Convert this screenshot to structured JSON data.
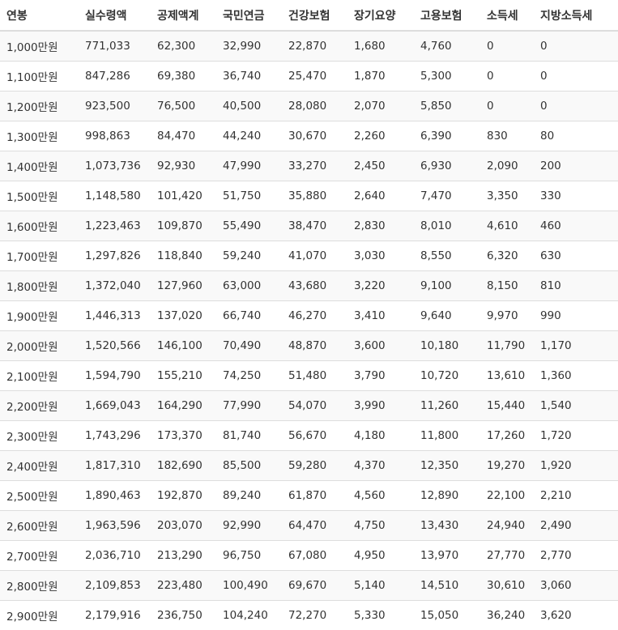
{
  "table": {
    "headers": [
      "연봉",
      "실수령액",
      "공제액계",
      "국민연금",
      "건강보험",
      "장기요양",
      "고용보험",
      "소득세",
      "지방소득세"
    ],
    "rows": [
      [
        "1,000만원",
        "771,033",
        "62,300",
        "32,990",
        "22,870",
        "1,680",
        "4,760",
        "0",
        "0"
      ],
      [
        "1,100만원",
        "847,286",
        "69,380",
        "36,740",
        "25,470",
        "1,870",
        "5,300",
        "0",
        "0"
      ],
      [
        "1,200만원",
        "923,500",
        "76,500",
        "40,500",
        "28,080",
        "2,070",
        "5,850",
        "0",
        "0"
      ],
      [
        "1,300만원",
        "998,863",
        "84,470",
        "44,240",
        "30,670",
        "2,260",
        "6,390",
        "830",
        "80"
      ],
      [
        "1,400만원",
        "1,073,736",
        "92,930",
        "47,990",
        "33,270",
        "2,450",
        "6,930",
        "2,090",
        "200"
      ],
      [
        "1,500만원",
        "1,148,580",
        "101,420",
        "51,750",
        "35,880",
        "2,640",
        "7,470",
        "3,350",
        "330"
      ],
      [
        "1,600만원",
        "1,223,463",
        "109,870",
        "55,490",
        "38,470",
        "2,830",
        "8,010",
        "4,610",
        "460"
      ],
      [
        "1,700만원",
        "1,297,826",
        "118,840",
        "59,240",
        "41,070",
        "3,030",
        "8,550",
        "6,320",
        "630"
      ],
      [
        "1,800만원",
        "1,372,040",
        "127,960",
        "63,000",
        "43,680",
        "3,220",
        "9,100",
        "8,150",
        "810"
      ],
      [
        "1,900만원",
        "1,446,313",
        "137,020",
        "66,740",
        "46,270",
        "3,410",
        "9,640",
        "9,970",
        "990"
      ],
      [
        "2,000만원",
        "1,520,566",
        "146,100",
        "70,490",
        "48,870",
        "3,600",
        "10,180",
        "11,790",
        "1,170"
      ],
      [
        "2,100만원",
        "1,594,790",
        "155,210",
        "74,250",
        "51,480",
        "3,790",
        "10,720",
        "13,610",
        "1,360"
      ],
      [
        "2,200만원",
        "1,669,043",
        "164,290",
        "77,990",
        "54,070",
        "3,990",
        "11,260",
        "15,440",
        "1,540"
      ],
      [
        "2,300만원",
        "1,743,296",
        "173,370",
        "81,740",
        "56,670",
        "4,180",
        "11,800",
        "17,260",
        "1,720"
      ],
      [
        "2,400만원",
        "1,817,310",
        "182,690",
        "85,500",
        "59,280",
        "4,370",
        "12,350",
        "19,270",
        "1,920"
      ],
      [
        "2,500만원",
        "1,890,463",
        "192,870",
        "89,240",
        "61,870",
        "4,560",
        "12,890",
        "22,100",
        "2,210"
      ],
      [
        "2,600만원",
        "1,963,596",
        "203,070",
        "92,990",
        "64,470",
        "4,750",
        "13,430",
        "24,940",
        "2,490"
      ],
      [
        "2,700만원",
        "2,036,710",
        "213,290",
        "96,750",
        "67,080",
        "4,950",
        "13,970",
        "27,770",
        "2,770"
      ],
      [
        "2,800만원",
        "2,109,853",
        "223,480",
        "100,490",
        "69,670",
        "5,140",
        "14,510",
        "30,610",
        "3,060"
      ],
      [
        "2,900만원",
        "2,179,916",
        "236,750",
        "104,240",
        "72,270",
        "5,330",
        "15,050",
        "36,240",
        "3,620"
      ]
    ]
  }
}
